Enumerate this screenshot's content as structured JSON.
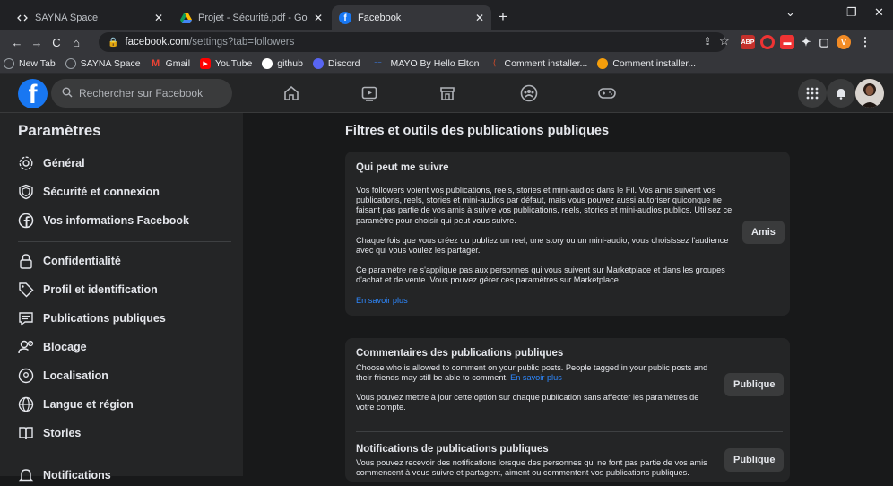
{
  "browser": {
    "tabs": [
      {
        "title": "SAYNA Space",
        "icon": "code-icon"
      },
      {
        "title": "Projet - Sécurité.pdf - Google Dr",
        "icon": "google-drive-icon"
      },
      {
        "title": "Facebook",
        "icon": "facebook-icon"
      }
    ],
    "url_domain": "facebook.com",
    "url_path": "/settings?tab=followers",
    "bookmarks": [
      {
        "label": "New Tab",
        "icon": "globe-icon",
        "color": "#9aa0a6"
      },
      {
        "label": "SAYNA Space",
        "icon": "globe-icon",
        "color": "#9aa0a6"
      },
      {
        "label": "Gmail",
        "icon": "gmail-icon",
        "color": "#ea4335"
      },
      {
        "label": "YouTube",
        "icon": "youtube-icon",
        "color": "#ff0000"
      },
      {
        "label": "github",
        "icon": "github-icon",
        "color": "#ffffff"
      },
      {
        "label": "Discord",
        "icon": "discord-icon",
        "color": "#5865f2"
      },
      {
        "label": "MAYO By Hello Elton",
        "icon": "mayo-icon",
        "color": "#3b82f6"
      },
      {
        "label": "Comment installer...",
        "icon": "bookmark-icon",
        "color": "#e34c26"
      },
      {
        "label": "Comment installer...",
        "icon": "bookmark-icon",
        "color": "#f59e0b"
      }
    ],
    "extensions": {
      "abp": "ABP",
      "profile": "V"
    }
  },
  "facebook": {
    "search_placeholder": "Rechercher sur Facebook"
  },
  "sidebar": {
    "title": "Paramètres",
    "items": [
      {
        "label": "Général",
        "icon": "gear-icon"
      },
      {
        "label": "Sécurité et connexion",
        "icon": "shield-icon"
      },
      {
        "label": "Vos informations Facebook",
        "icon": "facebook-circle-icon"
      },
      {
        "label": "Confidentialité",
        "icon": "lock-icon"
      },
      {
        "label": "Profil et identification",
        "icon": "tag-icon"
      },
      {
        "label": "Publications publiques",
        "icon": "public-posts-icon"
      },
      {
        "label": "Blocage",
        "icon": "block-user-icon"
      },
      {
        "label": "Localisation",
        "icon": "location-pin-icon"
      },
      {
        "label": "Langue et région",
        "icon": "globe-icon"
      },
      {
        "label": "Stories",
        "icon": "book-icon"
      },
      {
        "label": "Notifications",
        "icon": "bell-icon"
      }
    ]
  },
  "main": {
    "title": "Filtres et outils des publications publiques",
    "followers": {
      "heading": "Qui peut me suivre",
      "p1": "Vos followers voient vos publications, reels, stories et mini-audios dans le Fil. Vos amis suivent vos publications, reels, stories et mini-audios par défaut, mais vous pouvez aussi autoriser quiconque ne faisant pas partie de vos amis à suivre vos publications, reels, stories et mini-audios publics. Utilisez ce paramètre pour choisir qui peut vous suivre.",
      "p2": "Chaque fois que vous créez ou publiez un reel, une story ou un mini-audio, vous choisissez l'audience avec qui vous voulez les partager.",
      "p3": "Ce paramètre ne s'applique pas aux personnes qui vous suivent sur Marketplace et dans les groupes d'achat et de vente. Vous pouvez gérer ces paramètres sur Marketplace.",
      "link": "En savoir plus",
      "button": "Amis"
    },
    "comments": {
      "heading": "Commentaires des publications publiques",
      "p1": "Choose who is allowed to comment on your public posts. People tagged in your public posts and their friends may still be able to comment.",
      "link": "En savoir plus",
      "p2": "Vous pouvez mettre à jour cette option sur chaque publication sans affecter les paramètres de votre compte.",
      "button": "Publique"
    },
    "notifications": {
      "heading": "Notifications de publications publiques",
      "p1": "Vous pouvez recevoir des notifications lorsque des personnes qui ne font pas partie de vos amis commencent à vous suivre et partagent, aiment ou commentent vos publications publiques.",
      "button": "Publique"
    }
  }
}
